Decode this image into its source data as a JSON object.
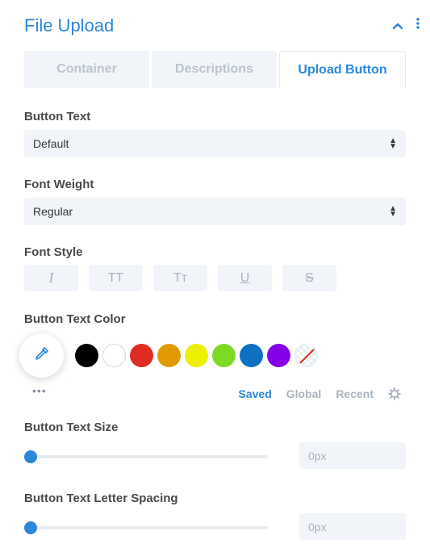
{
  "module": {
    "title": "File Upload",
    "collapse_icon": "chevron-up-icon",
    "menu_icon": "kebab-menu-icon"
  },
  "tabs": [
    {
      "label": "Container",
      "active": false
    },
    {
      "label": "Descriptions",
      "active": false
    },
    {
      "label": "Upload Button",
      "active": true
    }
  ],
  "fields": {
    "button_text": {
      "label": "Button Text",
      "value": "Default"
    },
    "font_weight": {
      "label": "Font Weight",
      "value": "Regular"
    },
    "font_style": {
      "label": "Font Style",
      "buttons": [
        {
          "glyph": "I",
          "icon": "italic-icon"
        },
        {
          "glyph": "TT",
          "icon": "uppercase-icon"
        },
        {
          "glyph": "Tт",
          "icon": "small-caps-icon"
        },
        {
          "glyph": "U",
          "icon": "underline-icon"
        },
        {
          "glyph": "S",
          "icon": "strikethrough-icon"
        }
      ]
    },
    "text_color": {
      "label": "Button Text Color",
      "picker_icon": "eyedropper-icon",
      "swatches": [
        "#000000",
        "#ffffff",
        "#e02b20",
        "#e09900",
        "#edf000",
        "#7cda24",
        "#0c71c3",
        "#8300e9",
        "none"
      ],
      "more_icon": "more-dots-icon",
      "tabs": [
        "Saved",
        "Global",
        "Recent"
      ],
      "active_tab": "Saved",
      "settings_icon": "gear-icon"
    },
    "text_size": {
      "label": "Button Text Size",
      "value": "0px",
      "level": 0
    },
    "letter_spacing": {
      "label": "Button Text Letter Spacing",
      "value": "0px",
      "level": 0
    }
  },
  "colors": {
    "accent": "#2b87da",
    "field_bg": "#f1f5f9",
    "muted": "#a8b3bd"
  }
}
